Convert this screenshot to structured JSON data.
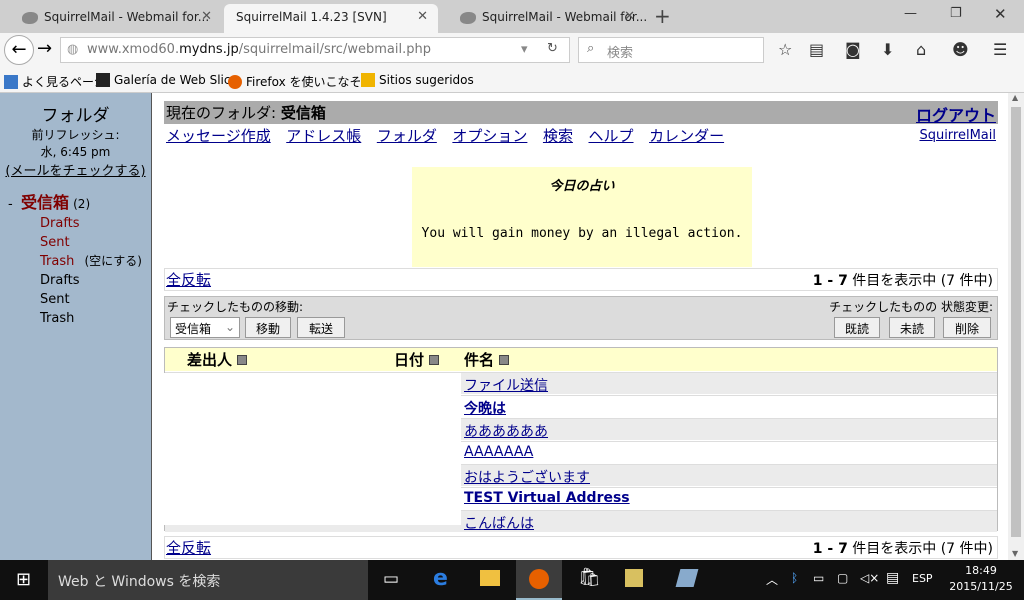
{
  "browser": {
    "tabs": [
      {
        "label": "SquirrelMail - Webmail for...",
        "active": false
      },
      {
        "label": "SquirrelMail 1.4.23 [SVN]",
        "active": true
      },
      {
        "label": "SquirrelMail - Webmail for...",
        "active": false
      }
    ],
    "url_prefix": "www.xmod60.",
    "url_domain": "mydns.jp",
    "url_path": "/squirrelmail/src/webmail.php",
    "search_placeholder": "検索",
    "bookmarks": [
      "よく見るページ",
      "Galería de Web Slice",
      "Firefox を使いこなそう",
      "Sitios sugeridos"
    ]
  },
  "sidebar": {
    "title": "フォルダ",
    "refresh_label": "前リフレッシュ:",
    "refresh_time": "水, 6:45 pm",
    "check_mail": "(メールをチェックする)",
    "inbox": "受信箱",
    "inbox_count": "(2)",
    "inbox_toggle": "-",
    "subfolders": [
      {
        "label": "Drafts"
      },
      {
        "label": "Sent"
      },
      {
        "label": "Trash",
        "extra": "(空にする)"
      }
    ],
    "folders": [
      "Drafts",
      "Sent",
      "Trash"
    ]
  },
  "main": {
    "current_folder_label": "現在のフォルダ:",
    "current_folder": "受信箱",
    "logout": "ログアウト",
    "menu": [
      "メッセージ作成",
      "アドレス帳",
      "フォルダ",
      "オプション",
      "検索",
      "ヘルプ",
      "カレンダー"
    ],
    "brand": "SquirrelMail",
    "fortune_title": "今日の占い",
    "fortune_text": "You will gain money by an illegal action.",
    "toggle_all": "全反転",
    "count_range": "1 - 7",
    "count_text": "件目を表示中 (7 件中)",
    "move_label": "チェックしたものの移動:",
    "status_label": "チェックしたものの 状態変更:",
    "move_select": "受信箱",
    "move_btn": "移動",
    "forward_btn": "転送",
    "read_btn": "既読",
    "unread_btn": "未読",
    "delete_btn": "削除",
    "columns": [
      "差出人",
      "日付",
      "件名"
    ],
    "messages": [
      {
        "subject": "ファイル送信",
        "unread": false
      },
      {
        "subject": "今晩は",
        "unread": true
      },
      {
        "subject": "ああああああ",
        "unread": false
      },
      {
        "subject": "AAAAAAA",
        "unread": false
      },
      {
        "subject": "おはようございます",
        "unread": false
      },
      {
        "subject": "TEST Virtual Address",
        "unread": true
      },
      {
        "subject": "こんばんは",
        "unread": false
      }
    ]
  },
  "taskbar": {
    "search": "Web と Windows を検索",
    "lang": "ESP",
    "time": "18:49",
    "date": "2015/11/25"
  }
}
